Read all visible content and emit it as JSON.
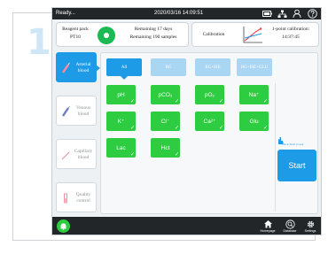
{
  "step_number": "1",
  "status_bar": {
    "state": "Ready...",
    "datetime": "2020/03/16 14:09:51",
    "icons": [
      "battery-icon",
      "network-icon",
      "user-icon",
      "help-icon"
    ]
  },
  "reagent": {
    "label_line1": "Reagent pack",
    "label_line2": "PT10",
    "remaining_days": "Remaining 17 days",
    "remaining_samples": "Remaining 190 samples"
  },
  "calibration": {
    "label": "Calibration",
    "result_line1": "1-point calibration:",
    "result_line2": "14:37:45"
  },
  "sample_types": [
    {
      "line1": "Arterial",
      "line2": "blood",
      "active": true
    },
    {
      "line1": "Venous",
      "line2": "blood",
      "active": false
    },
    {
      "line1": "Capillary",
      "line2": "blood",
      "active": false
    },
    {
      "line1": "Quality",
      "line2": "control",
      "active": false
    }
  ],
  "tabs": [
    "All",
    "BG",
    "BG+ISE",
    "BG+ISE+GLU"
  ],
  "parameters": [
    {
      "label": "pH",
      "selected": true
    },
    {
      "label": "pCO₂",
      "selected": true
    },
    {
      "label": "pO₂",
      "selected": true
    },
    {
      "label": "Na⁺",
      "selected": true
    },
    {
      "label": "K⁺",
      "selected": true
    },
    {
      "label": "Cl⁻",
      "selected": true
    },
    {
      "label": "Ca²⁺",
      "selected": true
    },
    {
      "label": "Glu",
      "selected": true
    },
    {
      "label": "Lac",
      "selected": true
    },
    {
      "label": "Hct",
      "selected": true
    }
  ],
  "start": {
    "hint": "Click Start to test",
    "label": "Start"
  },
  "bottom_bar": {
    "buttons": [
      {
        "label": "Homepage",
        "icon": "home-icon"
      },
      {
        "label": "Database",
        "icon": "search-icon"
      },
      {
        "label": "Settings",
        "icon": "gear-icon"
      }
    ]
  },
  "colors": {
    "accent": "#1e9be6",
    "accent_light": "#a9d6f3",
    "selected_param": "#2ecc40",
    "bar_dark": "#222629"
  }
}
